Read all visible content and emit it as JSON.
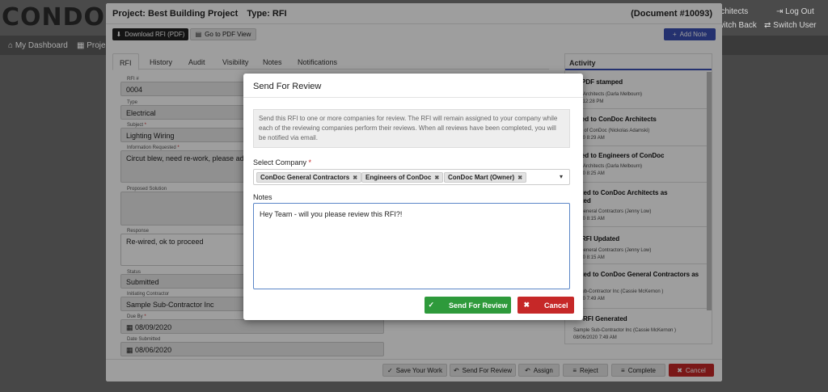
{
  "bg": {
    "logo": "CONDO",
    "architects": "rchitects",
    "switch_back": "witch Back",
    "log_out": "Log Out",
    "switch_user": "Switch User",
    "nav_dashboard": "My Dashboard",
    "nav_projects": "Proje"
  },
  "header": {
    "project": "Project: Best Building Project",
    "type": "Type: RFI",
    "document": "(Document #10093)"
  },
  "toolbar": {
    "download_label": "Download RFI (PDF)",
    "pdf_view_label": "Go to PDF View",
    "add_note_label": "Add Note"
  },
  "tabs": [
    "RFI",
    "History",
    "Audit",
    "Visibility",
    "Notes",
    "Notifications"
  ],
  "form": {
    "rfi_no_label": "RFI #",
    "rfi_no": "0004",
    "type_label": "Type",
    "type": "Electrical",
    "subject_label": "Subject",
    "subject": "Lighting Wiring",
    "info_label": "Information Requested",
    "info": "Circut blew, need re-work, please advise",
    "proposed_label": "Proposed Solution",
    "response_label": "Response",
    "response": "Re-wired, ok to proceed",
    "status_label": "Status",
    "status": "Submitted",
    "contractor_label": "Initiating Contractor",
    "contractor": "Sample Sub-Contractor Inc",
    "due_label": "Due By",
    "due": "08/09/2020",
    "submitted_label": "Date Submitted",
    "submitted": "08/06/2020"
  },
  "activity": {
    "title": "Activity",
    "items": [
      {
        "title": "PDF stamped",
        "sub1": "Doc Architects (Darla Melbourn)",
        "sub2": "0 at 12:28 PM"
      },
      {
        "title": "gned to ConDoc Architects",
        "sub1": "eers of ConDoc (Nickolas Adamski)",
        "sub2": "/2020 8:29 AM"
      },
      {
        "title": "gned to Engineers of ConDoc",
        "sub1": "Doc Architects (Darla Melbourn)",
        "sub2": "/2020 8:25 AM"
      },
      {
        "title": "nitted to ConDoc Architects as",
        "title2": "nitted",
        "sub1": "oc General Contractors (Jenny Low)",
        "sub2": "/2020 8:15 AM"
      },
      {
        "title": "RFI Updated",
        "sub1": "oc General Contractors (Jenny Low)",
        "sub2": "/2020 8:15 AM"
      },
      {
        "title": "nitted to ConDoc General Contractors as",
        "title2": "t",
        "sub1": "le Sub-Contractor Inc (Cassie McKernon )",
        "sub2": "/2020 7:49 AM"
      },
      {
        "title": "RFI Generated",
        "sub1": "Sample Sub-Contractor Inc (Cassie McKernon )",
        "sub2": "08/06/2020 7:49 AM"
      }
    ]
  },
  "footer": {
    "save": "Save Your Work",
    "send": "Send For Review",
    "assign": "Assign",
    "reject": "Reject",
    "complete": "Complete",
    "cancel": "Cancel"
  },
  "dialog": {
    "title": "Send For Review",
    "info": "Send this RFI to one or more companies for review. The RFI will remain assigned to your company while each of the reviewing companies perform their reviews. When all reviews have been completed, you will be notified via email.",
    "select_label": "Select Company",
    "companies": [
      "ConDoc General Contractors",
      "Engineers of ConDoc",
      "ConDoc Mart (Owner)"
    ],
    "notes_label": "Notes",
    "notes_value": "Hey Team - will you please review this RFI?!",
    "send_label": "Send For Review",
    "cancel_label": "Cancel"
  },
  "colors": {
    "primary": "#3b4fb4",
    "danger": "#c62828",
    "success": "#2e9a3b"
  }
}
